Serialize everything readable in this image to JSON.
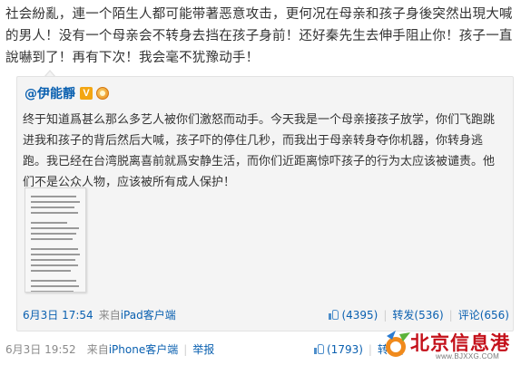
{
  "post": {
    "text": "社会紛亂，連一个陌生人都可能带著恶意攻击，更何况在母亲和孩子身後突然出現大喊的男人！没有一个母亲会不转身去挡在孩子身前！还好秦先生去伸手阻止你！孩子一直說嚇到了！再有下次！我会毫不犹豫动手！"
  },
  "repost": {
    "author": "@伊能靜",
    "badge": "V",
    "text": "终于知道爲甚么那么多艺人被你们激怒而动手。今天我是一个母亲接孩子放学，你们飞跑跳进我和孩子的背后然后大喊，孩子吓的停住几秒，而我出于母亲转身夺你机器，你转身逃跑。我已经在台湾脱离喜前就爲安静生活，而你们近距离惊吓孩子的行为太应该被谴责。他们不是公众人物，应该被所有成人保护！",
    "footer": {
      "date": "6月3日",
      "time": "17:54",
      "source_prefix": "来自",
      "source": "iPad客户端",
      "likes": "(4395)",
      "reposts": "转发(536)",
      "comments": "评论(656)"
    }
  },
  "footer": {
    "date": "6月3日",
    "time": "19:52",
    "source_prefix": "来自",
    "source": "iPhone客户端",
    "report": "举报",
    "likes": "(1793)",
    "reposts": "转发("
  },
  "watermark": {
    "title": "北京信息港",
    "url": "www.BJXXG.COM"
  },
  "colors": {
    "link": "#0a60b0",
    "muted": "#8a8a8a",
    "repost_bg": "#f4f4f4",
    "watermark_red": "#c4101a"
  }
}
